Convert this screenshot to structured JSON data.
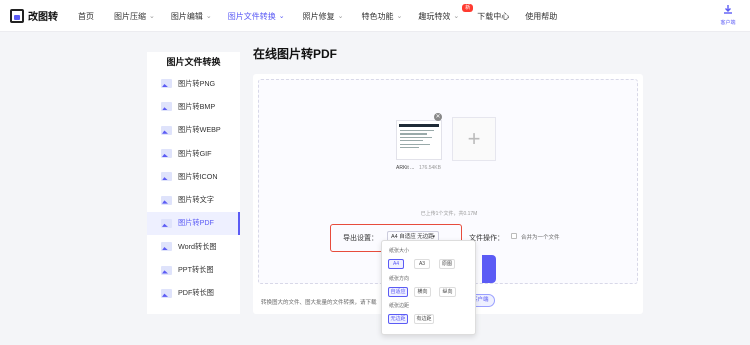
{
  "app": {
    "name": "改图转"
  },
  "nav": {
    "items": [
      {
        "label": "首页"
      },
      {
        "label": "图片压缩",
        "caret": "⌄"
      },
      {
        "label": "图片编辑",
        "caret": "⌄"
      },
      {
        "label": "图片文件转换",
        "caret": "⌄",
        "active": true
      },
      {
        "label": "照片修复",
        "caret": "⌄"
      },
      {
        "label": "特色功能",
        "caret": "⌄"
      },
      {
        "label": "趣玩特效",
        "caret": "⌄",
        "badge": "新"
      },
      {
        "label": "下载中心"
      },
      {
        "label": "使用帮助"
      }
    ],
    "client_label": "客户端"
  },
  "sidebar": {
    "title": "图片文件转换",
    "items": [
      {
        "label": "图片转PNG"
      },
      {
        "label": "图片转BMP"
      },
      {
        "label": "图片转WEBP"
      },
      {
        "label": "图片转GIF"
      },
      {
        "label": "图片转ICON"
      },
      {
        "label": "图片转文字"
      },
      {
        "label": "图片转PDF",
        "active": true
      },
      {
        "label": "Word转长图"
      },
      {
        "label": "PPT转长图"
      },
      {
        "label": "PDF转长图"
      }
    ]
  },
  "main": {
    "title": "在线图片转PDF",
    "file": {
      "name": "ARKit ...",
      "size": "176.54KB"
    },
    "add_symbol": "+",
    "upload_info": "已上传1个文件，共0.17M",
    "export_label": "导出设置：",
    "export_value": "A4 自适应 无边距",
    "file_op_label": "文件操作：",
    "merge_label": "合并为一个文件",
    "bottom_note": "转换图大的文件、图大批量的文件转换，请下载",
    "bottom_button": "客户端"
  },
  "dropdown": {
    "size_label": "纸张大小",
    "size_options": [
      "A4",
      "A3",
      "原图"
    ],
    "direction_label": "纸张方向",
    "direction_options": [
      "自适应",
      "横向",
      "纵向"
    ],
    "margin_label": "纸张边距",
    "margin_options": [
      "无边距",
      "有边距"
    ]
  },
  "colors": {
    "accent": "#5b5bf5",
    "highlight": "#e74c3c",
    "badge": "#ff3b30"
  },
  "icons": [
    "logo-icon",
    "download-client-icon",
    "image-icon",
    "plus-icon",
    "close-icon",
    "caret-down-icon"
  ]
}
